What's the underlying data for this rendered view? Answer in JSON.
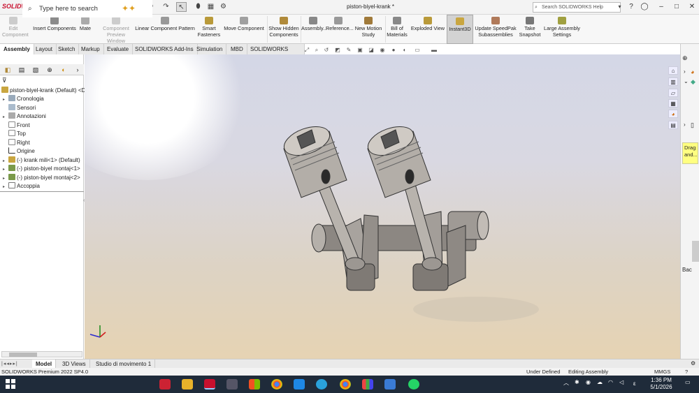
{
  "app": {
    "logo": "SOLIDWORKS",
    "doc_title": "piston-biyel-krank *"
  },
  "search": {
    "placeholder": "Search SOLIDWORKS Help"
  },
  "commands": [
    {
      "label": "Edit Component",
      "disabled": true
    },
    {
      "label": "Insert Components"
    },
    {
      "label": "Mate"
    },
    {
      "label": "Component Preview Window",
      "disabled": true
    },
    {
      "label": "Linear Component Pattern"
    },
    {
      "label": "Smart Fasteners"
    },
    {
      "label": "Move Component"
    },
    {
      "label": "Show Hidden Components"
    },
    {
      "label": "Assembly..."
    },
    {
      "label": "Reference..."
    },
    {
      "label": "New Motion Study"
    },
    {
      "label": "Bill of Materials"
    },
    {
      "label": "Exploded View"
    },
    {
      "label": "Instant3D",
      "active": true
    },
    {
      "label": "Update SpeedPak Subassemblies"
    },
    {
      "label": "Take Snapshot"
    },
    {
      "label": "Large Assembly Settings"
    }
  ],
  "tabs": [
    "Assembly",
    "Layout",
    "Sketch",
    "Markup",
    "Evaluate",
    "SOLIDWORKS Add-Ins",
    "Simulation",
    "MBD",
    "SOLIDWORKS CAM"
  ],
  "tree": {
    "root": "piston-biyel-krank (Default) <D",
    "items": [
      "Cronologia",
      "Sensori",
      "Annotazioni",
      "Front",
      "Top",
      "Right",
      "Origine",
      "(-) krank mili<1> (Default)",
      "(-) piston-biyel montaj<1>",
      "(-) piston-biyel montaj<2>",
      "Accoppia"
    ]
  },
  "bottom_tabs": [
    "Model",
    "3D Views",
    "Studio di movimento 1"
  ],
  "status": {
    "version": "SOLIDWORKS Premium 2022 SP4.0",
    "state": "Under Defined",
    "mode": "Editing Assembly",
    "units": "MMGS"
  },
  "taskpane": {
    "tooltip": "Drag and...",
    "bac": "Bac"
  },
  "taskbar": {
    "search": "Type here to search",
    "time": "1:36 PM",
    "date": "5/1/2026",
    "lang": "ε"
  },
  "colors": {
    "accent": "#c8102e",
    "taskbar": "#1f2b3a",
    "tooltip": "#ffff80"
  }
}
